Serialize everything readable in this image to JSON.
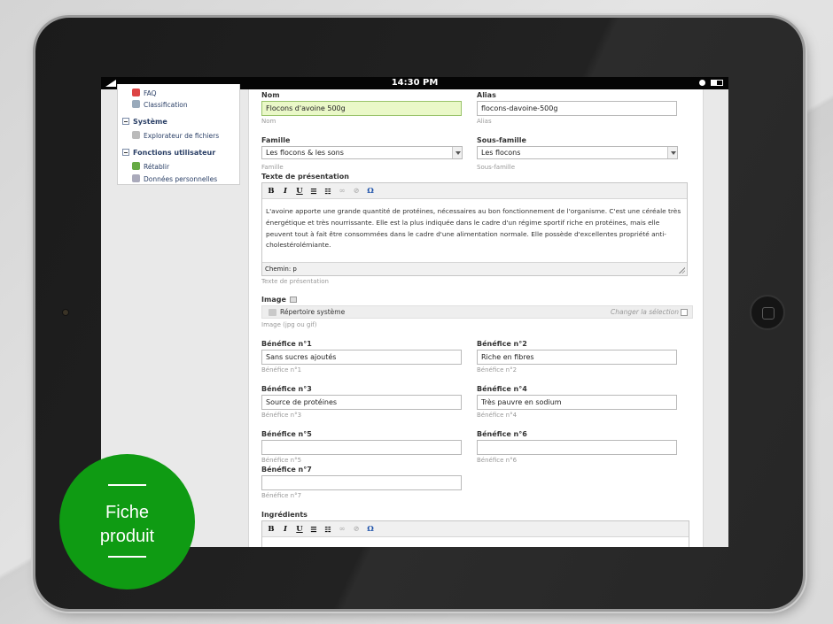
{
  "status_bar": {
    "time": "14:30 PM"
  },
  "sidebar": {
    "items_top": [
      {
        "label": "FAQ",
        "icon": "faq-icon"
      },
      {
        "label": "Classification",
        "icon": "tag-icon"
      }
    ],
    "system": {
      "heading": "Système",
      "items": [
        {
          "label": "Explorateur de fichiers",
          "icon": "files-icon"
        }
      ]
    },
    "user_functions": {
      "heading": "Fonctions utilisateur",
      "items": [
        {
          "label": "Rétablir",
          "icon": "undo-icon"
        },
        {
          "label": "Données personnelles",
          "icon": "user-data-icon"
        }
      ]
    }
  },
  "form": {
    "nom": {
      "label": "Nom",
      "value": "Flocons d'avoine 500g",
      "hint": "Nom"
    },
    "alias": {
      "label": "Alias",
      "value": "flocons-davoine-500g",
      "hint": "Alias"
    },
    "famille": {
      "label": "Famille",
      "value": "Les flocons & les sons",
      "hint": "Famille"
    },
    "sous_famille": {
      "label": "Sous-famille",
      "value": "Les flocons",
      "hint": "Sous-famille"
    },
    "presentation": {
      "label": "Texte de présentation",
      "text": "L'avoine apporte une grande quantité de protéines, nécessaires au bon fonctionnement de l'organisme. C'est une céréale très énergétique et très nourrissante. Elle est la plus indiquée dans le cadre d'un régime sportif riche en protéines, mais elle peuvent tout à fait être consommées dans le cadre d'une alimentation normale. Elle possède d'excellentes propriété anti-cholestérolémiante.",
      "path": "Chemin: p",
      "hint": "Texte de présentation"
    },
    "toolbar": {
      "bold": "B",
      "italic": "I",
      "underline": "U",
      "bullets": "☰",
      "numbers": "☷",
      "link": "∞",
      "unlink": "⊘",
      "omega": "Ω"
    },
    "image": {
      "label": "Image",
      "folder": "Répertoire système",
      "change": "Changer la sélection",
      "hint": "Image (jpg ou gif)"
    },
    "benefices": [
      {
        "label": "Bénéfice n°1",
        "value": "Sans sucres ajoutés",
        "hint": "Bénéfice n°1"
      },
      {
        "label": "Bénéfice n°2",
        "value": "Riche en fibres",
        "hint": "Bénéfice n°2"
      },
      {
        "label": "Bénéfice n°3",
        "value": "Source de protéines",
        "hint": "Bénéfice n°3"
      },
      {
        "label": "Bénéfice n°4",
        "value": "Très pauvre en sodium",
        "hint": "Bénéfice n°4"
      },
      {
        "label": "Bénéfice n°5",
        "value": "",
        "hint": "Bénéfice n°5"
      },
      {
        "label": "Bénéfice n°6",
        "value": "",
        "hint": "Bénéfice n°6"
      },
      {
        "label": "Bénéfice n°7",
        "value": "",
        "hint": "Bénéfice n°7"
      }
    ],
    "ingredients": {
      "label": "Ingrédients"
    }
  },
  "badge": {
    "line1": "Fiche",
    "line2": "produit",
    "color": "#0f9b13"
  }
}
